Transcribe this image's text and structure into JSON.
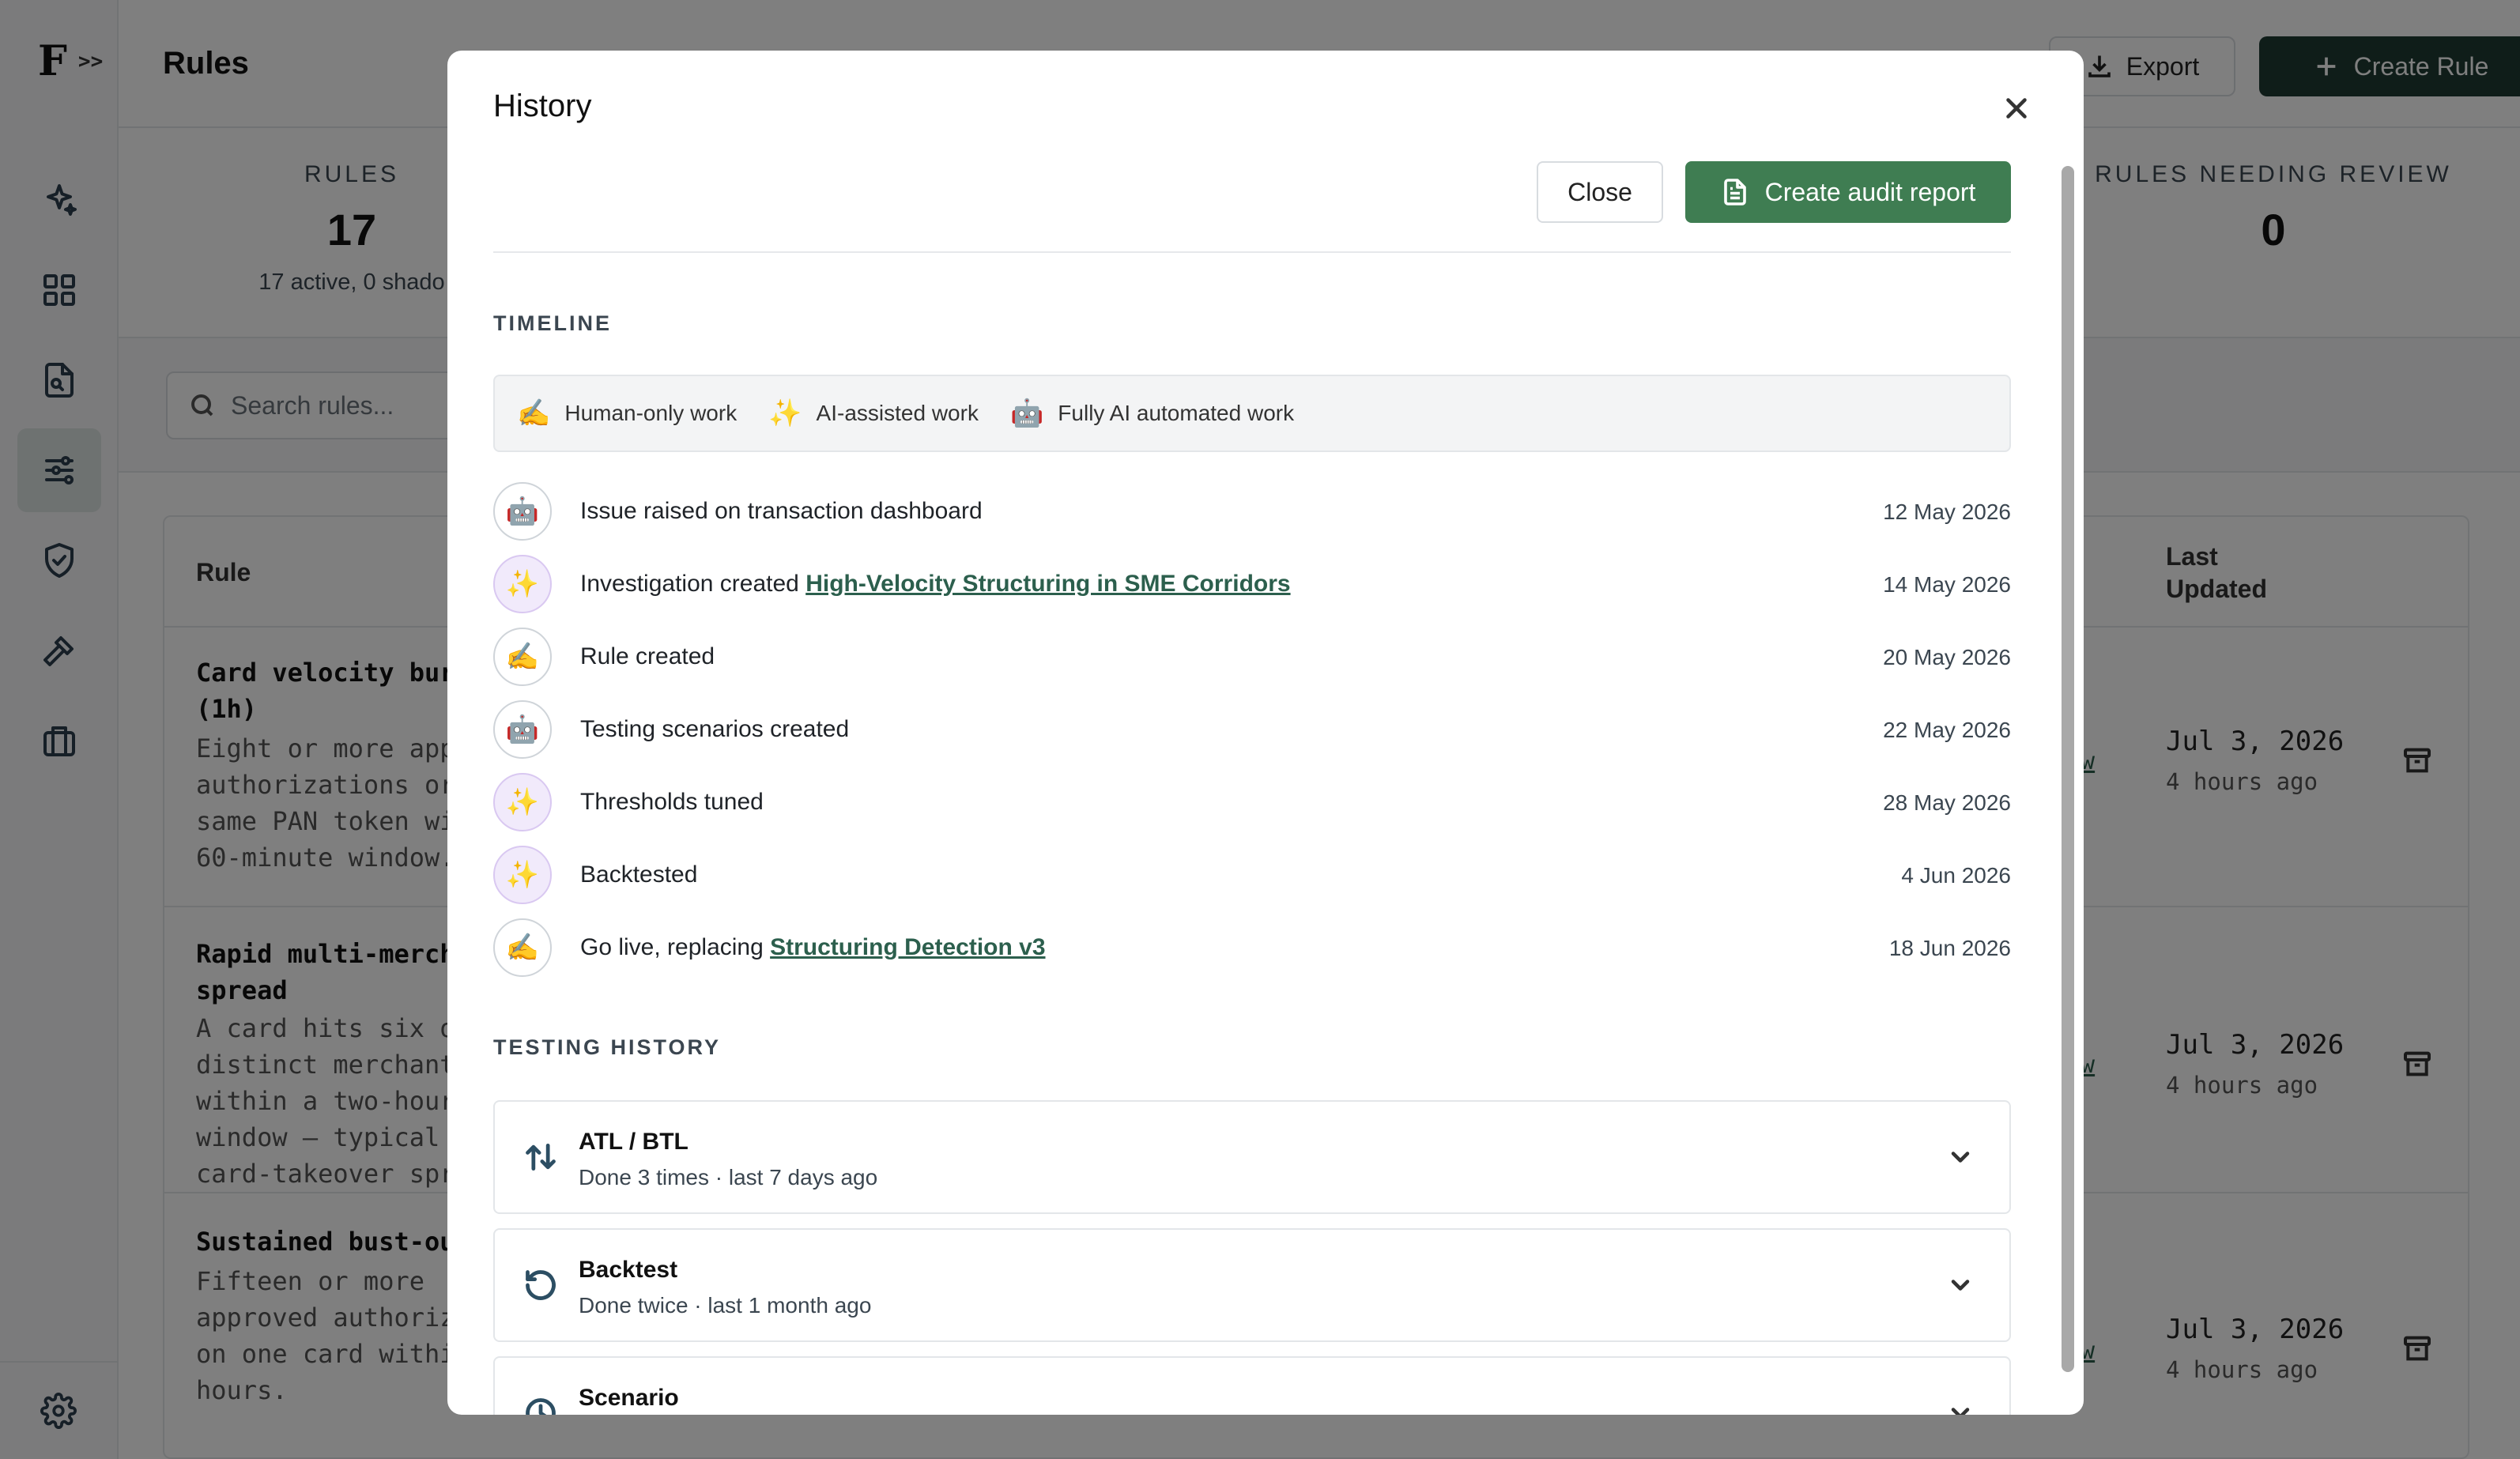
{
  "app": {
    "logo": "F",
    "expand_label": ">>",
    "page_title": "Rules",
    "export_label": "Export",
    "create_rule_label": "Create Rule",
    "search_placeholder": "Search rules..."
  },
  "stats": {
    "rules_label": "RULES",
    "rules_value": "17",
    "rules_sub": "17 active, 0 shado",
    "review_label": "RULES NEEDING REVIEW",
    "review_value": "0"
  },
  "table": {
    "col_rule": "Rule",
    "col_updated_1": "Last",
    "col_updated_2": "Updated",
    "rows": [
      {
        "name_lines": [
          "Card velocity bur",
          "(1h)"
        ],
        "desc_lines": [
          "Eight or more app",
          "authorizations or",
          "same PAN token wi",
          "60-minute window."
        ],
        "link": "ow",
        "date": "Jul 3, 2026",
        "ago": "4 hours ago"
      },
      {
        "name_lines": [
          "Rapid multi-merch",
          "spread"
        ],
        "desc_lines": [
          "A card hits six o",
          "distinct merchant",
          "within a two-hour",
          "window — typical",
          "card-takeover spr"
        ],
        "link": "ow",
        "date": "Jul 3, 2026",
        "ago": "4 hours ago"
      },
      {
        "name_lines": [
          "Sustained bust-ou"
        ],
        "desc_lines": [
          "Fifteen or more",
          "approved authoriz",
          "on one card withi",
          "hours."
        ],
        "link": "ow",
        "date": "Jul 3, 2026",
        "ago": "4 hours ago"
      }
    ]
  },
  "modal": {
    "title": "History",
    "close_label": "Close",
    "audit_label": "Create audit report",
    "timeline_label": "TIMELINE",
    "legend": [
      {
        "emoji": "✍️",
        "label": "Human-only work"
      },
      {
        "emoji": "✨",
        "label": "AI-assisted work"
      },
      {
        "emoji": "🤖",
        "label": "Fully AI automated work"
      }
    ],
    "timeline": [
      {
        "emoji": "🤖",
        "kind": "auto",
        "text": "Issue raised on transaction dashboard",
        "link": "",
        "date": "12 May 2026"
      },
      {
        "emoji": "✨",
        "kind": "ai",
        "text": "Investigation created ",
        "link": "High-Velocity Structuring in SME Corridors",
        "date": "14 May 2026"
      },
      {
        "emoji": "✍️",
        "kind": "human",
        "text": "Rule created",
        "link": "",
        "date": "20 May 2026"
      },
      {
        "emoji": "🤖",
        "kind": "auto",
        "text": "Testing scenarios created",
        "link": "",
        "date": "22 May 2026"
      },
      {
        "emoji": "✨",
        "kind": "ai",
        "text": "Thresholds tuned",
        "link": "",
        "date": "28 May 2026"
      },
      {
        "emoji": "✨",
        "kind": "ai",
        "text": "Backtested",
        "link": "",
        "date": "4 Jun 2026"
      },
      {
        "emoji": "✍️",
        "kind": "human",
        "text": "Go live, replacing ",
        "link": "Structuring Detection v3",
        "date": "18 Jun 2026"
      }
    ],
    "testing_label": "TESTING HISTORY",
    "testing": [
      {
        "icon": "arrows-up-down-icon",
        "name": "ATL / BTL",
        "sub": "Done 3 times · last 7 days ago"
      },
      {
        "icon": "history-icon",
        "name": "Backtest",
        "sub": "Done twice · last 1 month ago"
      },
      {
        "icon": "scenario-icon",
        "name": "Scenario",
        "sub": ""
      }
    ]
  },
  "colors": {
    "primary_dark": "#1f3a33",
    "audit_green": "#3f7d52",
    "link_green": "#2c5f4d",
    "overlay": "rgba(0,0,0,0.5)"
  }
}
